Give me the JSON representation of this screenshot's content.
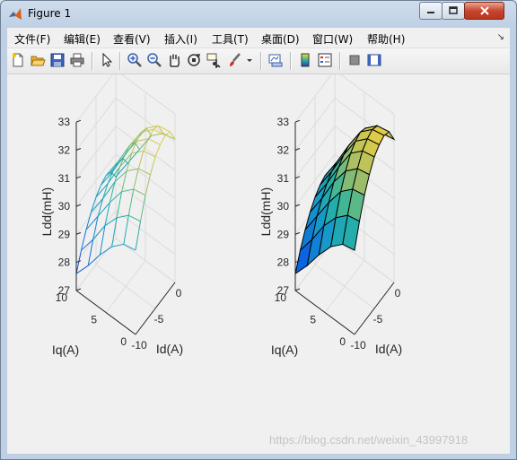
{
  "window": {
    "title": "Figure 1"
  },
  "menu": [
    "文件(F)",
    "编辑(E)",
    "查看(V)",
    "插入(I)",
    "工具(T)",
    "桌面(D)",
    "窗口(W)",
    "帮助(H)"
  ],
  "toolbar": [
    "new-figure-icon",
    "open-file-icon",
    "save-icon",
    "print-icon",
    "pointer-icon",
    "zoom-in-icon",
    "zoom-out-icon",
    "pan-icon",
    "rotate-3d-icon",
    "data-cursor-icon",
    "brush-icon",
    "link-plot-icon",
    "colorbar-icon",
    "legend-icon",
    "hide-plot-tools-icon",
    "show-plot-tools-icon"
  ],
  "chart_data": [
    {
      "type": "mesh",
      "zlabel": "Ldd(mH)",
      "xlabel": "Id(A)",
      "ylabel": "Iq(A)",
      "xlim": [
        -10,
        0
      ],
      "ylim": [
        0,
        10
      ],
      "zlim": [
        27,
        33
      ],
      "xticks": [
        "-10",
        "-5",
        "0"
      ],
      "yticks": [
        "0",
        "5",
        "10"
      ],
      "zticks": [
        "27",
        "28",
        "29",
        "30",
        "31",
        "32",
        "33"
      ],
      "grid": true,
      "x": [
        -10,
        -8.75,
        -7.5,
        -6.25,
        -5,
        -3.75,
        -2.5,
        -1.25,
        0
      ],
      "y": [
        0,
        2,
        4,
        6,
        8,
        10
      ],
      "z": [
        [
          30.0,
          30.8,
          31.5,
          32.0,
          32.4,
          32.6,
          32.7,
          32.6,
          32.1
        ],
        [
          29.9,
          30.7,
          31.4,
          31.9,
          32.3,
          32.5,
          32.6,
          32.5,
          32.0
        ],
        [
          29.5,
          30.3,
          31.0,
          31.5,
          31.9,
          32.1,
          32.2,
          32.1,
          31.6
        ],
        [
          28.9,
          29.7,
          30.3,
          30.8,
          31.1,
          31.3,
          31.4,
          31.3,
          30.8
        ],
        [
          28.2,
          28.9,
          29.5,
          29.9,
          30.2,
          30.4,
          30.5,
          30.4,
          30.0
        ],
        [
          27.6,
          28.2,
          28.7,
          29.1,
          29.4,
          29.6,
          29.7,
          29.6,
          29.2
        ]
      ]
    },
    {
      "type": "surface",
      "zlabel": "Ldd(mH)",
      "xlabel": "Id(A)",
      "ylabel": "Iq(A)",
      "xlim": [
        -10,
        0
      ],
      "ylim": [
        0,
        10
      ],
      "zlim": [
        27,
        33
      ],
      "xticks": [
        "-10",
        "-5",
        "0"
      ],
      "yticks": [
        "0",
        "5",
        "10"
      ],
      "zticks": [
        "27",
        "28",
        "29",
        "30",
        "31",
        "32",
        "33"
      ],
      "grid": true,
      "x": [
        -10,
        -8.75,
        -7.5,
        -6.25,
        -5,
        -3.75,
        -2.5,
        -1.25,
        0
      ],
      "y": [
        0,
        2,
        4,
        6,
        8,
        10
      ],
      "z": [
        [
          30.0,
          30.8,
          31.5,
          32.0,
          32.4,
          32.6,
          32.7,
          32.6,
          32.1
        ],
        [
          29.9,
          30.7,
          31.4,
          31.9,
          32.3,
          32.5,
          32.6,
          32.5,
          32.0
        ],
        [
          29.5,
          30.3,
          31.0,
          31.5,
          31.9,
          32.1,
          32.2,
          32.1,
          31.6
        ],
        [
          28.9,
          29.7,
          30.3,
          30.8,
          31.1,
          31.3,
          31.4,
          31.3,
          30.8
        ],
        [
          28.2,
          28.9,
          29.5,
          29.9,
          30.2,
          30.4,
          30.5,
          30.4,
          30.0
        ],
        [
          27.6,
          28.2,
          28.7,
          29.1,
          29.4,
          29.6,
          29.7,
          29.6,
          29.2
        ]
      ]
    }
  ],
  "watermark": "https://blog.csdn.net/weixin_43997918"
}
